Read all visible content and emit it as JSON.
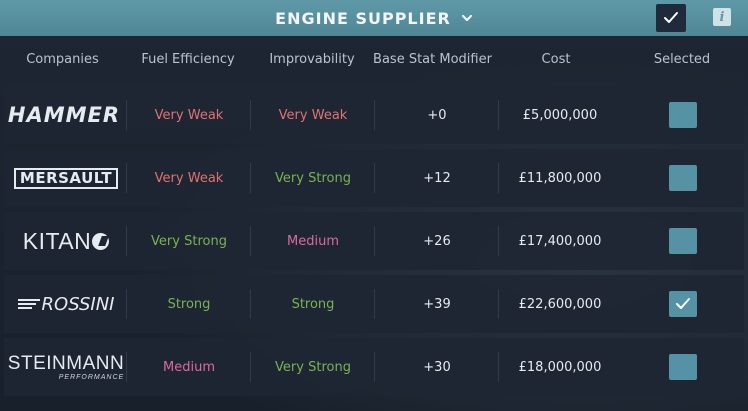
{
  "header": {
    "title": "ENGINE SUPPLIER",
    "chevron_icon": "chevron-down-icon",
    "confirm_icon": "checkmark-icon",
    "info_icon": "info-icon",
    "info_glyph": "i"
  },
  "columns": [
    "Companies",
    "Fuel Efficiency",
    "Improvability",
    "Base Stat Modifier",
    "Cost",
    "Selected"
  ],
  "rows": [
    {
      "company": "HAMMER",
      "fuel_efficiency": "Very Weak",
      "fuel_level": "weak",
      "improvability": "Very Weak",
      "improvability_level": "weak",
      "base_stat_modifier": "+0",
      "cost": "£5,000,000",
      "selected": false
    },
    {
      "company": "MERSAULT",
      "fuel_efficiency": "Very Weak",
      "fuel_level": "weak",
      "improvability": "Very Strong",
      "improvability_level": "strong",
      "base_stat_modifier": "+12",
      "cost": "£11,800,000",
      "selected": false
    },
    {
      "company": "KITANO",
      "company_display": "KITAN",
      "fuel_efficiency": "Very Strong",
      "fuel_level": "strong",
      "improvability": "Medium",
      "improvability_level": "medium",
      "base_stat_modifier": "+26",
      "cost": "£17,400,000",
      "selected": false
    },
    {
      "company": "ROSSINI",
      "fuel_efficiency": "Strong",
      "fuel_level": "strong",
      "improvability": "Strong",
      "improvability_level": "strong",
      "base_stat_modifier": "+39",
      "cost": "£22,600,000",
      "selected": true
    },
    {
      "company": "STEINMANN",
      "company_sub": "PERFORMANCE",
      "fuel_efficiency": "Medium",
      "fuel_level": "medium",
      "improvability": "Very Strong",
      "improvability_level": "strong",
      "base_stat_modifier": "+30",
      "cost": "£18,000,000",
      "selected": false
    }
  ],
  "colors": {
    "header_bar": "#5f99a8",
    "weak": "#e07272",
    "strong": "#78b354",
    "medium": "#d96aa3",
    "checkbox": "#5592a3"
  }
}
